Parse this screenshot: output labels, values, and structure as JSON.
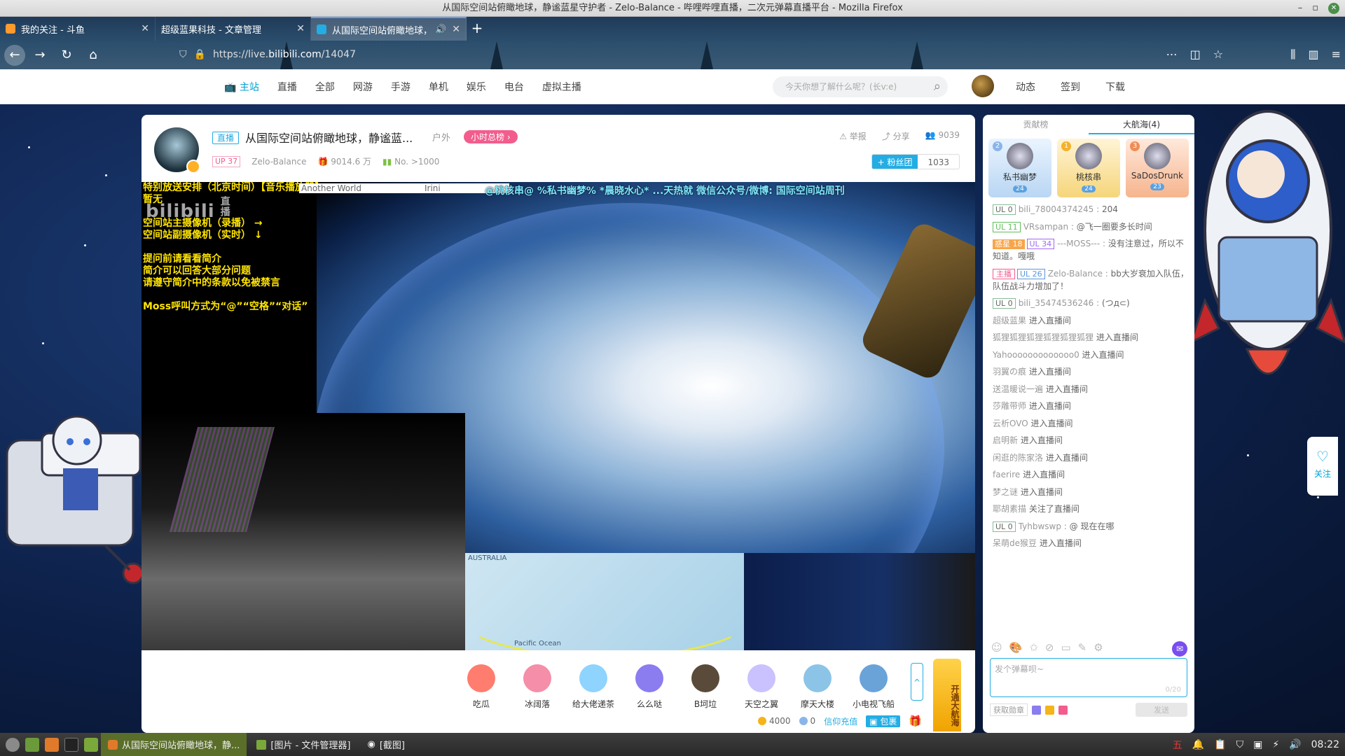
{
  "window": {
    "title": "从国际空间站俯瞰地球，静谧蓝星守护者 - Zelo-Balance - 哔哩哔哩直播，二次元弹幕直播平台 - Mozilla Firefox"
  },
  "tabs": [
    {
      "label": "我的关注 - 斗鱼",
      "close": "✕"
    },
    {
      "label": "超级蓝果科技 - 文章管理",
      "close": "✕"
    },
    {
      "label": "从国际空间站俯瞰地球，",
      "close": "✕"
    }
  ],
  "address": {
    "url_prefix": "https://live.",
    "url_domain": "bilibili.com",
    "url_path": "/14047"
  },
  "site_nav": {
    "items": [
      "主站",
      "直播",
      "全部",
      "网游",
      "手游",
      "单机",
      "娱乐",
      "电台",
      "虚拟主播"
    ]
  },
  "search": {
    "placeholder": "今天你想了解什么呢？(长v:e)"
  },
  "user_links": [
    "动态",
    "签到",
    "下载"
  ],
  "room": {
    "live_tag": "直播",
    "title": "从国际空间站俯瞰地球，静谧蓝...",
    "area": "户外",
    "rank_pill": "小时总榜",
    "ul_badge": "UP 37",
    "streamer": "Zelo-Balance",
    "popularity": "9014.6 万",
    "rank_no": "No. >1000",
    "report": "举报",
    "share": "分享",
    "viewers": "9039",
    "fans_btn": "+ 粉丝团",
    "fans_count": "1033"
  },
  "video": {
    "osd_lines": [
      "特别放送安排（北京时间）【音乐播放器】",
      "暂无",
      "",
      "空间站主摄像机（录播）    →",
      "空间站副摄像机（实时）    ↓",
      "",
      "提问前请看看简介",
      "简介可以回答大部分问题",
      "请遵守简介中的条款以免被禁言",
      "",
      "Moss呼叫方式为“@”“空格”“对话”"
    ],
    "song": "Another World",
    "artist": "Irini",
    "danmaku": "@桃核串@  %私书幽梦%  *晨晓水心*  ...天热就  微信公众号/微博: 国际空间站周刊",
    "watermark": "bilibili",
    "watermark_sub": "直播",
    "map_label1": "AUSTRALIA",
    "map_label2": "Pacific Ocean"
  },
  "gifts": [
    {
      "label": "吃瓜",
      "color": "#ff7d6e"
    },
    {
      "label": "冰阔落",
      "color": "#f58ea8"
    },
    {
      "label": "给大佬递茶",
      "color": "#8fd3ff"
    },
    {
      "label": "么么哒",
      "color": "#8b7cf0"
    },
    {
      "label": "B坷垃",
      "color": "#5a4a3a"
    },
    {
      "label": "天空之翼",
      "color": "#c9c2ff"
    },
    {
      "label": "摩天大楼",
      "color": "#8cc4e8"
    },
    {
      "label": "小电视飞船",
      "color": "#6aa3d8"
    }
  ],
  "gift_more": "^",
  "guard_btn": "开通大航海",
  "wallet": {
    "gold": "4000",
    "silver": "0",
    "recharge": "信仰充值",
    "package": "包裹"
  },
  "sidebar": {
    "tabs": [
      "贡献榜",
      "大航海(4)"
    ],
    "guards": [
      {
        "rank": "2",
        "name": "私书幽梦",
        "lv": "24"
      },
      {
        "rank": "1",
        "name": "桃核串",
        "lv": "24"
      },
      {
        "rank": "3",
        "name": "SaDosDrunk",
        "lv": "23"
      }
    ],
    "messages": [
      {
        "ul": "UL 0",
        "name": "bili_78004374245",
        "text": "204"
      },
      {
        "ul": "UL 11",
        "name": "VRsampan",
        "text": "@飞一圈要多长时间"
      },
      {
        "medal": "惑星 18",
        "ul": "UL 34",
        "name": "---MOSS---",
        "text": "没有注意过，所以不知道。嘎哦"
      },
      {
        "host": "主播",
        "ul": "UL 26",
        "name": "Zelo-Balance",
        "text": "bb大岁衰加入队伍，队伍战斗力增加了！"
      },
      {
        "ul": "UL 0",
        "name": "bili_35474536246",
        "text": "(つд⊂)"
      },
      {
        "name": "超级蓝果",
        "text": "进入直播间"
      },
      {
        "name": "狐狸狐狸狐狸狐狸狐狸狐狸",
        "text": "进入直播间"
      },
      {
        "name": "Yahooooooooooooo0",
        "text": "进入直播间"
      },
      {
        "name": "羽翼の痕",
        "text": "进入直播间"
      },
      {
        "name": "送温暖说一遍",
        "text": "进入直播间"
      },
      {
        "name": "莎雕带师",
        "text": "进入直播间"
      },
      {
        "name": "云析OVO",
        "text": "进入直播间"
      },
      {
        "name": "启明新",
        "text": "进入直播间"
      },
      {
        "name": "闲逛的陈家洛",
        "text": "进入直播间"
      },
      {
        "name": "faerire",
        "text": "进入直播间"
      },
      {
        "name": "梦之谜",
        "text": "进入直播间"
      },
      {
        "name": "耶胡素描",
        "text": "关注了直播间"
      },
      {
        "ul": "UL 0",
        "name": "Tyhbwswp",
        "text": "@ 现在在哪"
      },
      {
        "name": "呆萌de猴豆",
        "text": "进入直播间"
      }
    ],
    "input_placeholder": "发个弹幕呗~",
    "input_count": "0/20",
    "get_medal": "获取勋章",
    "send": "发送"
  },
  "follow_side": "关注",
  "taskbar": {
    "items": [
      "从国际空间站俯瞰地球，静...",
      "[图片 - 文件管理器]",
      "[截图]"
    ],
    "time": "08:22"
  }
}
